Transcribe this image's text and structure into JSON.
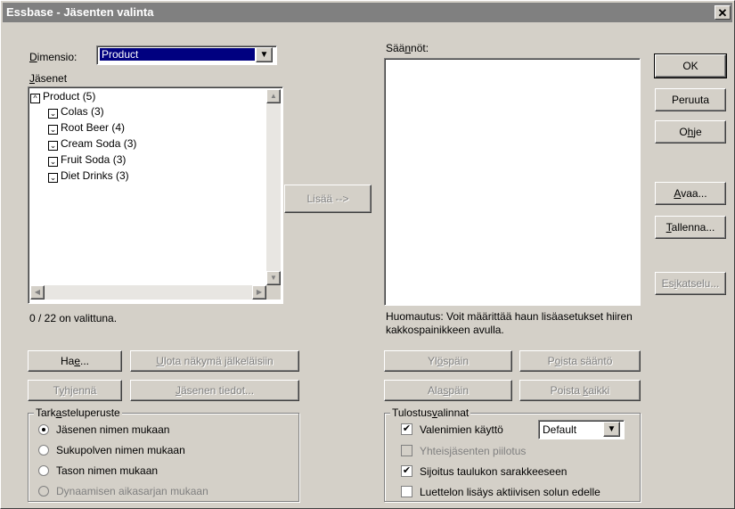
{
  "window": {
    "title": "Essbase - Jäsenten valinta",
    "close_glyph": "✕"
  },
  "dimension": {
    "label_prefix": "",
    "label_u": "D",
    "label_rest": "imensio:",
    "value": "Product"
  },
  "members": {
    "label_u": "J",
    "label_rest": "äsenet",
    "root": {
      "glyph": "^",
      "label": "Product  (5)"
    },
    "items": [
      {
        "glyph": "⌄",
        "label": "Colas  (3)"
      },
      {
        "glyph": "⌄",
        "label": "Root Beer  (4)"
      },
      {
        "glyph": "⌄",
        "label": "Cream Soda  (3)"
      },
      {
        "glyph": "⌄",
        "label": "Fruit Soda  (3)"
      },
      {
        "glyph": "⌄",
        "label": "Diet Drinks  (3)"
      }
    ],
    "selected_count": "0 / 22 on valittuna."
  },
  "buttons": {
    "search_pre": "Ha",
    "search_u": "e",
    "search_post": "...",
    "expand_pre": "",
    "expand_u": "U",
    "expand_post": "lota näkymä jälkeläisiin",
    "clear_pre": "T",
    "clear_u": "y",
    "clear_post": "hjennä",
    "member_info_pre": "",
    "member_info_u": "J",
    "member_info_post": "äsenen tiedot...",
    "add": "Lisää -->",
    "up_pre": "Yl",
    "up_u": "ö",
    "up_post": "späin",
    "remove_rule_pre": "P",
    "remove_rule_u": "o",
    "remove_rule_post": "ista sääntö",
    "down_pre": "Ala",
    "down_u": "s",
    "down_post": "päin",
    "remove_all_pre": "Poista ",
    "remove_all_u": "k",
    "remove_all_post": "aikki",
    "ok": "OK",
    "cancel": "Peruuta",
    "help_pre": "O",
    "help_u": "h",
    "help_post": "je",
    "open_pre": "",
    "open_u": "A",
    "open_post": "vaa...",
    "save_pre": "",
    "save_u": "T",
    "save_post": "allenna...",
    "preview_pre": "Es",
    "preview_u": "i",
    "preview_post": "katselu..."
  },
  "criteria": {
    "title_pre": "Tark",
    "title_u": "a",
    "title_post": "steluperuste",
    "options": [
      {
        "label": "Jäsenen nimen mukaan",
        "selected": true,
        "disabled": false
      },
      {
        "label": "Sukupolven nimen mukaan",
        "selected": false,
        "disabled": false
      },
      {
        "label": "Tason nimen mukaan",
        "selected": false,
        "disabled": false
      },
      {
        "label": "Dynaamisen aikasarjan mukaan",
        "selected": false,
        "disabled": true
      }
    ]
  },
  "rules": {
    "label_pre": "Sää",
    "label_u": "n",
    "label_post": "nöt:",
    "note": "Huomautus: Voit määrittää haun lisäasetukset hiiren kakkospainikkeen avulla."
  },
  "output": {
    "title_pre": "Tulostus",
    "title_u": "v",
    "title_post": "alinnat",
    "alias_label": "Valenimien käyttö",
    "alias_value": "Default",
    "options": [
      {
        "label": "Valenimien käyttö",
        "checked": true,
        "disabled": false
      },
      {
        "label": "Yhteisjäsenten piilotus",
        "checked": false,
        "disabled": true
      },
      {
        "label": "Sijoitus taulukon sarakkeeseen",
        "checked": true,
        "disabled": false
      },
      {
        "label": "Luettelon lisäys aktiivisen solun edelle",
        "checked": false,
        "disabled": false
      }
    ]
  },
  "glyphs": {
    "check": "✔",
    "arrow_down": "▼",
    "arrow_up": "▲",
    "arrow_left": "◀",
    "arrow_right": "▶"
  }
}
